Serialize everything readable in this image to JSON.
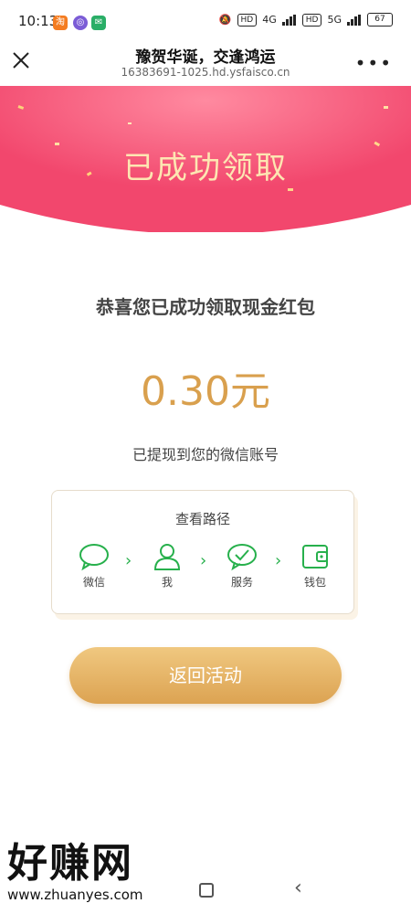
{
  "statusbar": {
    "time": "10:13",
    "battery": "67",
    "net1": "4G",
    "net2": "5G",
    "hd": "HD"
  },
  "header": {
    "title": "豫贺华诞，交逢鸿运",
    "url": "16383691-1025.hd.ysfaisco.cn"
  },
  "banner": {
    "title": "已成功领取"
  },
  "main": {
    "congrats": "恭喜您已成功领取现金红包",
    "amount": "0.30元",
    "note": "已提现到您的微信账号"
  },
  "path": {
    "title": "查看路径",
    "steps": [
      {
        "label": "微信",
        "icon": "chat-bubble-icon"
      },
      {
        "label": "我",
        "icon": "person-icon"
      },
      {
        "label": "服务",
        "icon": "check-chat-icon"
      },
      {
        "label": "钱包",
        "icon": "wallet-icon"
      }
    ]
  },
  "actions": {
    "return_label": "返回活动"
  },
  "watermark": {
    "big": "好赚网",
    "small": "www.zhuanyes.com"
  },
  "colors": {
    "banner": "#f2476d",
    "gold": "#d9a04e",
    "green": "#27b04c"
  }
}
